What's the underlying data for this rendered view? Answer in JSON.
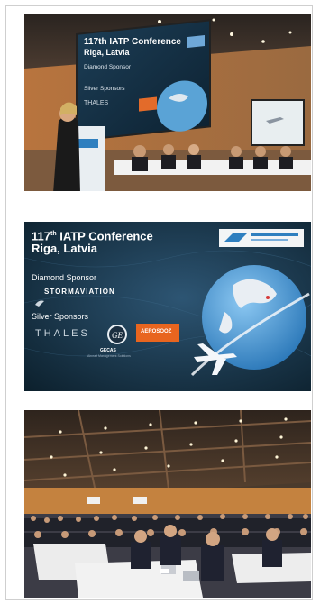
{
  "slide_main": {
    "title_line1": "117",
    "title_sup": "th",
    "title_line1_rest": " IATP Conference",
    "title_line2": "Riga, Latvia",
    "diamond_label": "Diamond Sponsor",
    "diamond_sponsor": "STORMAVIATION",
    "silver_label": "Silver Sponsors",
    "silver_sponsor_1": "THALES",
    "silver_sponsor_3": "AEROSOOZ",
    "gecas": "GECAS",
    "gecas_sub": "Aircraft Management Solutions"
  },
  "photo1_slide": {
    "title_line1": "117th IATP Conference",
    "title_line2": "Riga, Latvia",
    "diamond_label": "Diamond Sponsor",
    "silver_label": "Silver Sponsors",
    "silver_sponsor_1": "THALES"
  }
}
